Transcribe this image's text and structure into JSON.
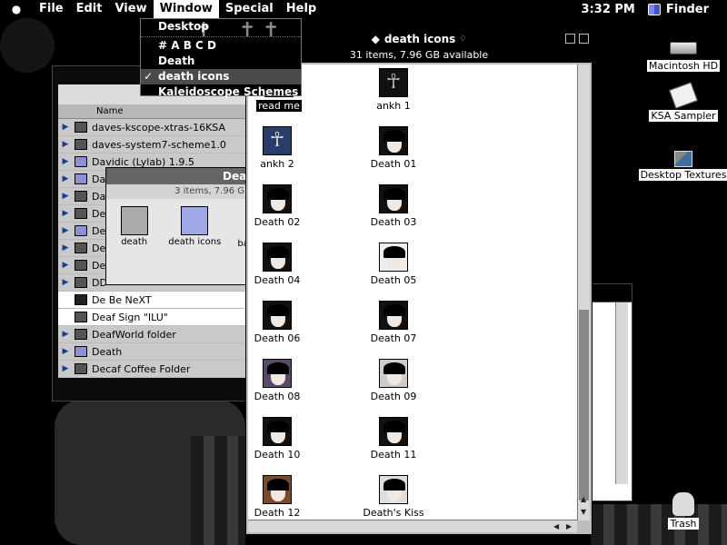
{
  "menubar": {
    "apple": "",
    "items": [
      "File",
      "Edit",
      "View",
      "Window",
      "Special",
      "Help"
    ],
    "active": "Window",
    "clock": "3:32 PM",
    "app": "Finder"
  },
  "window_menu": {
    "items": [
      "Desktop",
      "# A B C D",
      "Death",
      "death icons",
      "Kaleidoscope Schemes"
    ],
    "checked": "death icons"
  },
  "list_window": {
    "column_header": "Name",
    "rows": [
      {
        "label": "daves-kscope-xtras-16KSA",
        "folder": true
      },
      {
        "label": "daves-system7-scheme1.0",
        "folder": true
      },
      {
        "label": "Davidic (Lylab) 1.9.5",
        "folder": true
      },
      {
        "label": "Da",
        "folder": true
      },
      {
        "label": "Da",
        "folder": true
      },
      {
        "label": "De",
        "folder": true
      },
      {
        "label": "De",
        "folder": true
      },
      {
        "label": "De",
        "folder": true
      },
      {
        "label": "De",
        "folder": true
      },
      {
        "label": "DD",
        "folder": true
      },
      {
        "label": "De Be NeXT",
        "folder": false
      },
      {
        "label": "Deaf Sign \"ILU\"",
        "folder": false
      },
      {
        "label": "DeafWorld folder",
        "folder": true
      },
      {
        "label": "Death",
        "folder": true
      },
      {
        "label": "Decaf Coffee Folder",
        "folder": true
      }
    ]
  },
  "small_window": {
    "title": "Dea",
    "info": "3 items, 7.96 G",
    "items": [
      "death",
      "death icons",
      "ba"
    ]
  },
  "main_window": {
    "title": "death icons",
    "info": "31 items, 7.96 GB available",
    "items": [
      {
        "label": "read me",
        "type": "ankh",
        "highlight": true
      },
      {
        "label": "ankh 1",
        "type": "ankh",
        "highlight": false
      },
      {
        "label": "ankh 2",
        "type": "ankh",
        "highlight": false
      },
      {
        "label": "Death 01",
        "type": "face",
        "highlight": false
      },
      {
        "label": "Death 02",
        "type": "face",
        "highlight": false
      },
      {
        "label": "Death 03",
        "type": "face",
        "highlight": false
      },
      {
        "label": "Death 04",
        "type": "face",
        "highlight": false
      },
      {
        "label": "Death 05",
        "type": "face",
        "highlight": false
      },
      {
        "label": "Death 06",
        "type": "face",
        "highlight": false
      },
      {
        "label": "Death 07",
        "type": "face",
        "highlight": false
      },
      {
        "label": "Death 08",
        "type": "face",
        "highlight": false
      },
      {
        "label": "Death 09",
        "type": "face",
        "highlight": false
      },
      {
        "label": "Death 10",
        "type": "face",
        "highlight": false
      },
      {
        "label": "Death 11",
        "type": "face",
        "highlight": false
      },
      {
        "label": "Death 12",
        "type": "face",
        "highlight": false
      },
      {
        "label": "Death's Kiss",
        "type": "face",
        "highlight": false
      }
    ]
  },
  "desktop_icons": {
    "hd": "Macintosh HD",
    "ksa": "KSA Sampler",
    "textures": "Desktop Textures",
    "trash": "Trash"
  },
  "colors": {
    "menubar": "#000000",
    "selection": "#4a4a4a",
    "folder_triangle": "#1a3b8f"
  }
}
